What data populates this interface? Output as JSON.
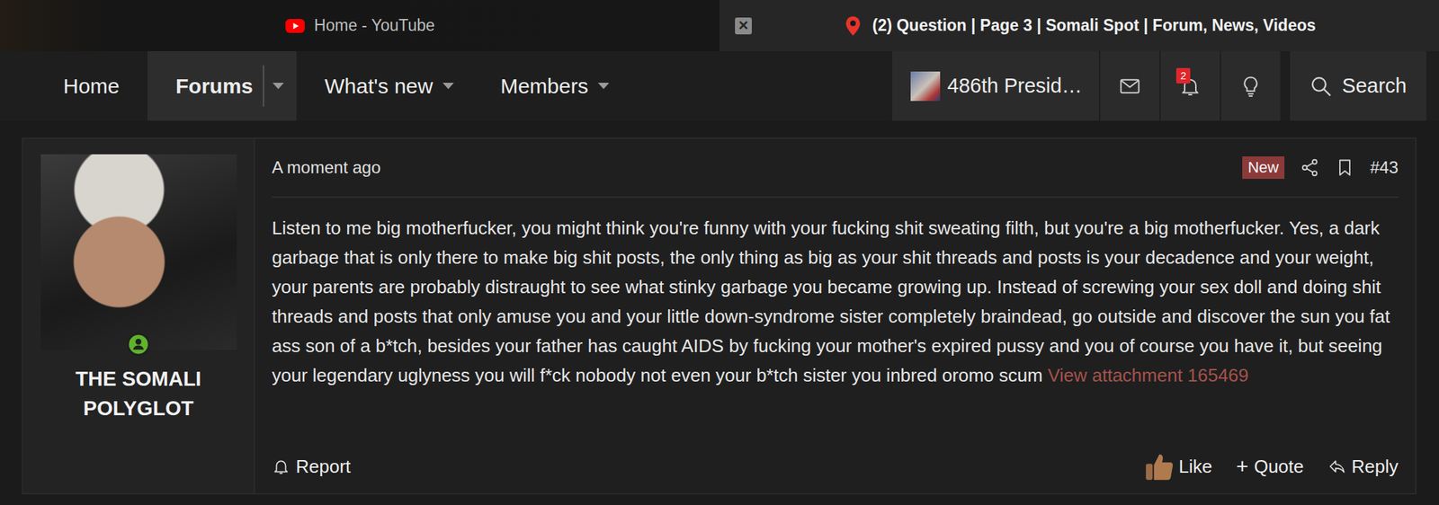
{
  "browser_tabs": [
    {
      "label": "Home - YouTube",
      "selected": false,
      "closable": false
    },
    {
      "label": "(2) Question | Page 3 | Somali Spot | Forum, News, Videos",
      "selected": true,
      "closable": true
    }
  ],
  "tab_close_icon": "×",
  "nav": {
    "items": [
      {
        "label": "Home",
        "selected": false,
        "dropdown": false
      },
      {
        "label": "Forums",
        "selected": true,
        "dropdown": true
      },
      {
        "label": "What's new",
        "selected": false,
        "dropdown": true
      },
      {
        "label": "Members",
        "selected": false,
        "dropdown": true
      }
    ],
    "user": "486th Presid…",
    "alerts_count": "2",
    "search": "Search"
  },
  "post": {
    "author": "THE SOMALI POLYGLOT",
    "online": true,
    "time": "A moment ago",
    "badge": "New",
    "number": "#43",
    "body": "Listen to me big motherfucker, you might think you're funny with your fucking shit sweating filth, but you're a big motherfucker. Yes, a dark garbage that is only there to make big shit posts, the only thing as big as your shit threads and posts is your decadence and your weight, your parents are probably distraught to see what stinky garbage you became growing up. Instead of screwing your sex doll and doing shit threads and posts that only amuse you and your little down-syndrome sister completely braindead, go outside and discover the sun you fat ass son of a b*tch, besides your father has caught AIDS by fucking your mother's expired pussy and you of course you have it, but seeing your legendary uglyness you will f*ck nobody not even your b*tch sister you inbred oromo scum",
    "attachment": "View attachment 165469",
    "actions": {
      "report": "Report",
      "like": "Like",
      "quote_icon": "+",
      "quote": "Quote",
      "reply": "Reply"
    }
  }
}
